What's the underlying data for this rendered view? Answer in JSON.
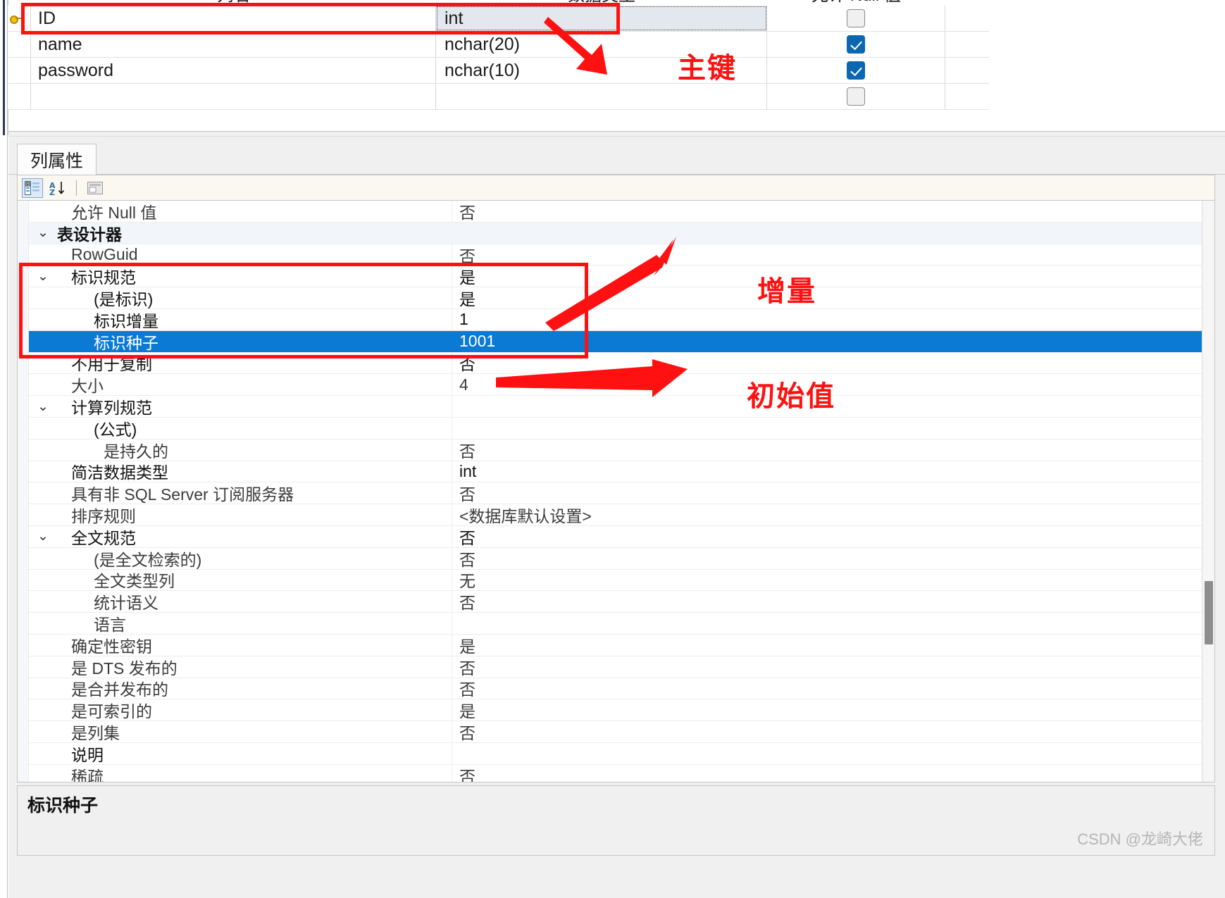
{
  "column_grid": {
    "headers": {
      "name": "列名",
      "type": "数据类型",
      "allow_null": "允许 Null 值"
    },
    "rows": [
      {
        "key": true,
        "name": "ID",
        "type": "int",
        "allow_null": false,
        "selected": true
      },
      {
        "key": false,
        "name": "name",
        "type": "nchar(20)",
        "allow_null": true,
        "selected": false
      },
      {
        "key": false,
        "name": "password",
        "type": "nchar(10)",
        "allow_null": true,
        "selected": false
      },
      {
        "key": false,
        "name": "",
        "type": "",
        "allow_null": false,
        "selected": false
      }
    ]
  },
  "properties_pane": {
    "tab_label": "列属性",
    "toolbar": {
      "categorized_icon": "categorized-view-icon",
      "alphabetical_icon": "alphabetical-sort-icon",
      "property_pages_icon": "property-pages-icon"
    },
    "rows": [
      {
        "label": "允许 Null 值",
        "value": "否",
        "indent": 1,
        "kind": "dim"
      },
      {
        "label": "表设计器",
        "value": "",
        "indent": 0,
        "kind": "category",
        "expander": "⌄"
      },
      {
        "label": "RowGuid",
        "value": "否",
        "indent": 1,
        "kind": "dim"
      },
      {
        "label": "标识规范",
        "value": "是",
        "indent": 1,
        "kind": "bold",
        "expander": "⌄"
      },
      {
        "label": "(是标识)",
        "value": "是",
        "indent": 2,
        "kind": "bold"
      },
      {
        "label": "标识增量",
        "value": "1",
        "indent": 2,
        "kind": "bold"
      },
      {
        "label": "标识种子",
        "value": "1001",
        "indent": 2,
        "kind": "selected"
      },
      {
        "label": "不用于复制",
        "value": "否",
        "indent": 1,
        "kind": "bold"
      },
      {
        "label": "大小",
        "value": "4",
        "indent": 1,
        "kind": "dim"
      },
      {
        "label": "计算列规范",
        "value": "",
        "indent": 1,
        "kind": "bold",
        "expander": "⌄"
      },
      {
        "label": "(公式)",
        "value": "",
        "indent": 2,
        "kind": "bold"
      },
      {
        "label": "是持久的",
        "value": "否",
        "indent": 3,
        "kind": "dim"
      },
      {
        "label": "简洁数据类型",
        "value": "int",
        "indent": 1,
        "kind": "bold"
      },
      {
        "label": "具有非 SQL Server 订阅服务器",
        "value": "否",
        "indent": 1,
        "kind": "dim"
      },
      {
        "label": "排序规则",
        "value": "<数据库默认设置>",
        "indent": 1,
        "kind": "dim"
      },
      {
        "label": "全文规范",
        "value": "否",
        "indent": 1,
        "kind": "bold",
        "expander": "⌄"
      },
      {
        "label": "(是全文检索的)",
        "value": "否",
        "indent": 2,
        "kind": "dim"
      },
      {
        "label": "全文类型列",
        "value": "无",
        "indent": 2,
        "kind": "dim"
      },
      {
        "label": "统计语义",
        "value": "否",
        "indent": 2,
        "kind": "dim"
      },
      {
        "label": "语言",
        "value": "",
        "indent": 2,
        "kind": "dim"
      },
      {
        "label": "确定性密钥",
        "value": "是",
        "indent": 1,
        "kind": "dim"
      },
      {
        "label": "是 DTS 发布的",
        "value": "否",
        "indent": 1,
        "kind": "dim"
      },
      {
        "label": "是合并发布的",
        "value": "否",
        "indent": 1,
        "kind": "dim"
      },
      {
        "label": "是可索引的",
        "value": "是",
        "indent": 1,
        "kind": "dim"
      },
      {
        "label": "是列集",
        "value": "否",
        "indent": 1,
        "kind": "dim"
      },
      {
        "label": "说明",
        "value": "",
        "indent": 1,
        "kind": "bold"
      },
      {
        "label": "稀疏",
        "value": "否",
        "indent": 1,
        "kind": "dim"
      }
    ]
  },
  "description_bar": {
    "title": "标识种子"
  },
  "watermark": {
    "text": "CSDN @龙崎大佬"
  },
  "annotations": {
    "primary_key": "主键",
    "increment": "增量",
    "seed": "初始值",
    "color": "#ff1111"
  }
}
